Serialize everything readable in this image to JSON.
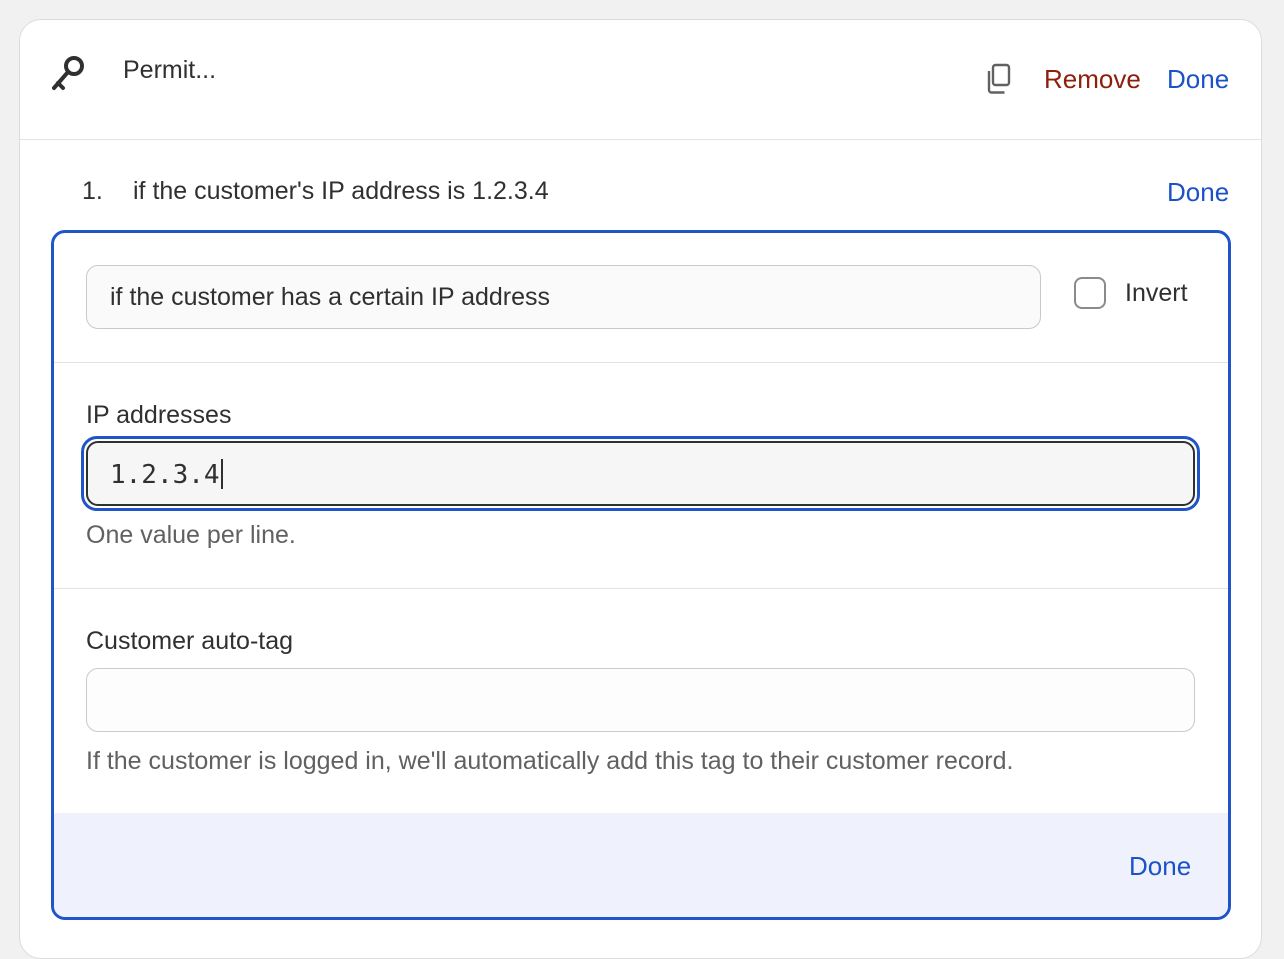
{
  "header": {
    "title": "Permit...",
    "remove_label": "Remove",
    "done_label": "Done",
    "icons": {
      "leading": "key-icon",
      "copy": "copy-icon"
    }
  },
  "rule": {
    "number": "1.",
    "summary": "if the customer's IP address is 1.2.3.4",
    "done_label": "Done"
  },
  "condition": {
    "selected": "if the customer has a certain IP address",
    "invert_label": "Invert",
    "invert_checked": false
  },
  "ip_addresses": {
    "label": "IP addresses",
    "value": "1.2.3.4",
    "help": "One value per line."
  },
  "auto_tag": {
    "label": "Customer auto-tag",
    "value": "",
    "help": "If the customer is logged in, we'll automatically add this tag to their customer record."
  },
  "footer": {
    "done_label": "Done"
  },
  "colors": {
    "accent": "#1c52c8",
    "danger": "#8e1f0b",
    "footer_bg": "#eff2fd"
  }
}
